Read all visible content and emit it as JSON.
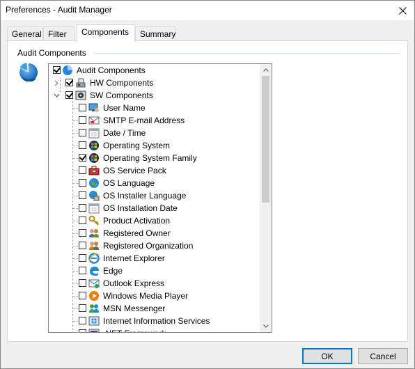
{
  "window": {
    "title": "Preferences - Audit Manager"
  },
  "tabs": [
    {
      "label": "General",
      "active": false
    },
    {
      "label": "Filter",
      "active": false
    },
    {
      "label": "Components",
      "active": true
    },
    {
      "label": "Summary",
      "active": false
    }
  ],
  "group": {
    "label": "Audit Components"
  },
  "tree": {
    "root": {
      "label": "Audit Components",
      "checked": true
    },
    "hw": {
      "label": "HW Components",
      "checked": true,
      "expanded": false
    },
    "sw": {
      "label": "SW Components",
      "checked": true,
      "expanded": true
    },
    "items": [
      {
        "label": "User Name",
        "checked": false,
        "icon": "user-monitor-icon"
      },
      {
        "label": "SMTP E-mail Address",
        "checked": false,
        "icon": "email-icon"
      },
      {
        "label": "Date / Time",
        "checked": false,
        "icon": "calendar-icon"
      },
      {
        "label": "Operating System",
        "checked": false,
        "icon": "os-icon"
      },
      {
        "label": "Operating System Family",
        "checked": true,
        "icon": "os-family-icon"
      },
      {
        "label": "OS Service Pack",
        "checked": false,
        "icon": "service-pack-icon"
      },
      {
        "label": "OS Language",
        "checked": false,
        "icon": "globe-icon"
      },
      {
        "label": "OS Installer Language",
        "checked": false,
        "icon": "installer-globe-icon"
      },
      {
        "label": "OS Installation Date",
        "checked": false,
        "icon": "calendar-icon"
      },
      {
        "label": "Product Activation",
        "checked": false,
        "icon": "key-icon"
      },
      {
        "label": "Registered Owner",
        "checked": false,
        "icon": "users-icon"
      },
      {
        "label": "Registered Organization",
        "checked": false,
        "icon": "organization-icon"
      },
      {
        "label": "Internet Explorer",
        "checked": false,
        "icon": "internet-explorer-icon"
      },
      {
        "label": "Edge",
        "checked": false,
        "icon": "edge-icon"
      },
      {
        "label": "Outlook Express",
        "checked": false,
        "icon": "outlook-express-icon"
      },
      {
        "label": "Windows Media Player",
        "checked": false,
        "icon": "media-player-icon"
      },
      {
        "label": "MSN Messenger",
        "checked": false,
        "icon": "messenger-icon"
      },
      {
        "label": "Internet Information Services",
        "checked": false,
        "icon": "iis-icon"
      },
      {
        "label": ".NET Framework",
        "checked": false,
        "icon": "dotnet-icon"
      }
    ]
  },
  "buttons": {
    "ok": "OK",
    "cancel": "Cancel"
  },
  "colors": {
    "accent": "#0078d7",
    "ie_blue": "#1e88e5"
  }
}
